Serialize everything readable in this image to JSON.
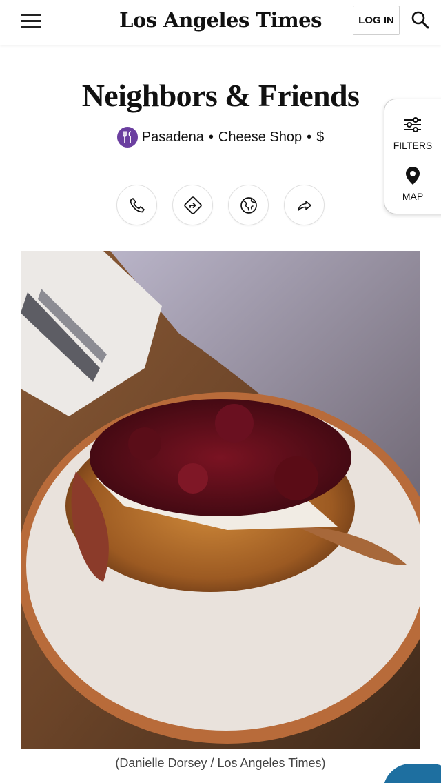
{
  "header": {
    "logo": "Los Angeles Times",
    "login_label": "LOG IN",
    "menu_icon": "hamburger-menu-icon",
    "search_icon": "search-icon"
  },
  "place": {
    "name": "Neighbors & Friends",
    "neighborhood": "Pasadena",
    "category": "Cheese Shop",
    "price": "$",
    "separator": "•",
    "category_icon": "utensils-icon",
    "category_color": "#6b3fa0"
  },
  "actions": [
    {
      "icon": "phone-icon"
    },
    {
      "icon": "directions-icon"
    },
    {
      "icon": "globe-icon"
    },
    {
      "icon": "share-icon"
    }
  ],
  "side_panel": {
    "filters_label": "FILTERS",
    "map_label": "MAP"
  },
  "photo": {
    "caption": "(Danielle Dorsey / Los Angeles Times)"
  }
}
